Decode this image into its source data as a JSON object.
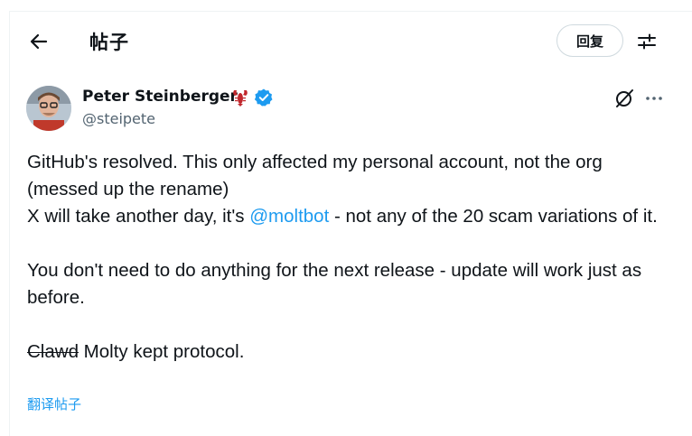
{
  "header": {
    "title": "帖子",
    "reply_label": "回复",
    "icons": {
      "back": "arrow-left-icon",
      "adjust": "sliders-icon"
    }
  },
  "post": {
    "author": {
      "name": "Peter Steinberger",
      "emoji": "lobster-emoji",
      "verified": true,
      "handle": "@steipete"
    },
    "body": {
      "line1": "GitHub's resolved. This only affected my personal account, not the org (messed up the rename)",
      "line2_before": "X will take another day, it's ",
      "line2_mention": "@moltbot",
      "line2_after": " - not any of the 20 scam variations of it.",
      "line3": "You don't need to do anything for the next release - update will work just as before.",
      "line4_struck": "Clawd",
      "line4_rest": " Molty kept protocol."
    },
    "translate_label": "翻译帖子"
  },
  "colors": {
    "accent": "#1d9bf0",
    "text": "#0f1419",
    "muted": "#536471",
    "border": "#cfd9de"
  }
}
